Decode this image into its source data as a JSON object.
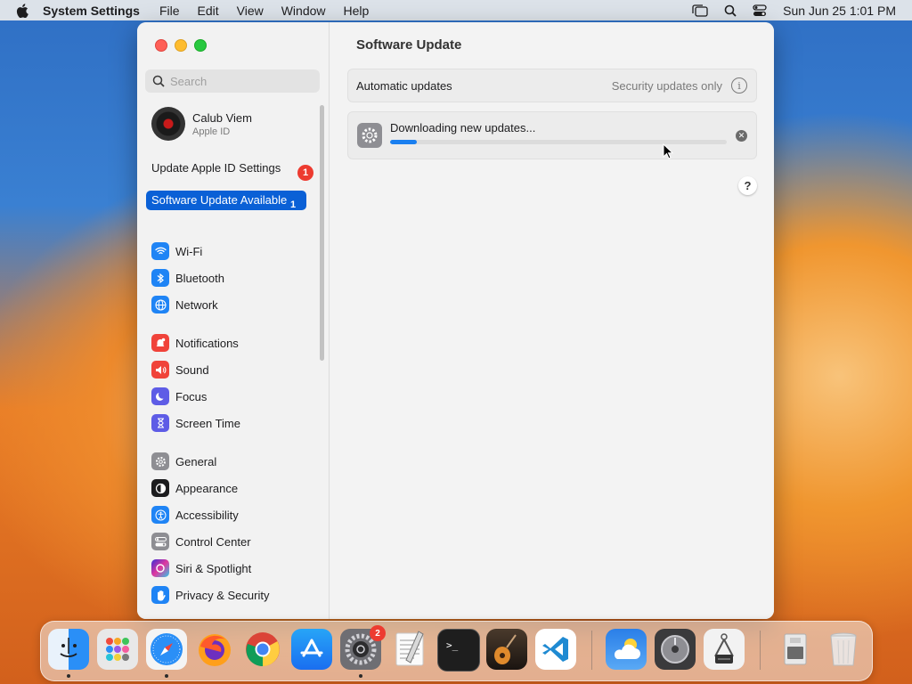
{
  "menubar": {
    "app_name": "System Settings",
    "menus": [
      "File",
      "Edit",
      "View",
      "Window",
      "Help"
    ],
    "datetime": "Sun Jun 25  1:01 PM"
  },
  "sidebar": {
    "search_placeholder": "Search",
    "account": {
      "name": "Calub Viem",
      "subtitle": "Apple ID"
    },
    "notices": [
      {
        "label": "Update Apple ID Settings",
        "badge": "1"
      },
      {
        "label": "Software Update Available",
        "badge": "1"
      }
    ],
    "items": [
      {
        "label": "Wi-Fi",
        "icon": "wifi-icon"
      },
      {
        "label": "Bluetooth",
        "icon": "bluetooth-icon"
      },
      {
        "label": "Network",
        "icon": "network-icon"
      },
      {
        "label": "Notifications",
        "icon": "notifications-icon"
      },
      {
        "label": "Sound",
        "icon": "sound-icon"
      },
      {
        "label": "Focus",
        "icon": "focus-icon"
      },
      {
        "label": "Screen Time",
        "icon": "hourglass-icon"
      },
      {
        "label": "General",
        "icon": "gear-icon"
      },
      {
        "label": "Appearance",
        "icon": "appearance-icon"
      },
      {
        "label": "Accessibility",
        "icon": "accessibility-icon"
      },
      {
        "label": "Control Center",
        "icon": "control-center-icon"
      },
      {
        "label": "Siri & Spotlight",
        "icon": "siri-icon"
      },
      {
        "label": "Privacy & Security",
        "icon": "hand-icon"
      }
    ]
  },
  "content": {
    "title": "Software Update",
    "automatic_updates": {
      "label": "Automatic updates",
      "value": "Security updates only"
    },
    "download": {
      "status": "Downloading new updates...",
      "progress": 0.08
    },
    "help": "?"
  },
  "dock": {
    "apps": [
      "Finder",
      "Launchpad",
      "Safari",
      "Firefox",
      "Chrome",
      "App Store",
      "System Settings",
      "TextEdit",
      "Terminal",
      "GarageBand",
      "Visual Studio Code",
      "Weather",
      "Disk Utility",
      "System Information",
      "Downloads",
      "Trash"
    ],
    "settings_badge": "2"
  },
  "colors": {
    "accent": "#0a60d6",
    "badge": "#ed3b30",
    "progress": "#1a7ff0"
  }
}
